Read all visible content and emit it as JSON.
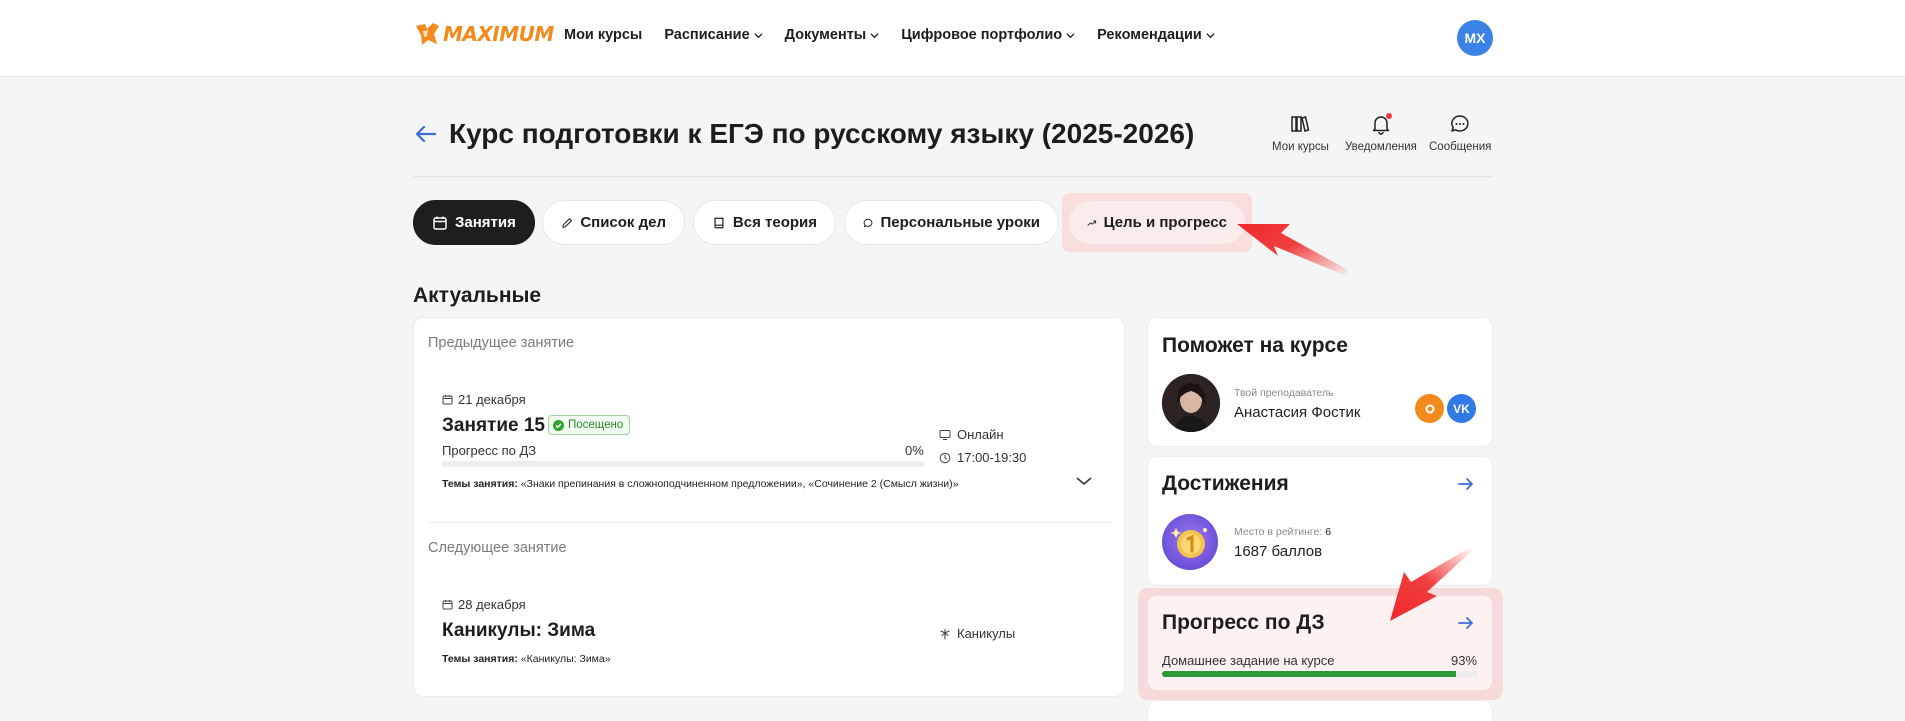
{
  "header": {
    "logo_text": "MAXIMUM",
    "nav": [
      {
        "label": "Мои курсы",
        "dropdown": false
      },
      {
        "label": "Расписание",
        "dropdown": true
      },
      {
        "label": "Документы",
        "dropdown": true
      },
      {
        "label": "Цифровое портфолио",
        "dropdown": true
      },
      {
        "label": "Рекомендации",
        "dropdown": true
      }
    ],
    "avatar_initials": "МХ"
  },
  "page": {
    "title": "Курс подготовки к ЕГЭ по русскому языку (2025-2026)",
    "quick_links": [
      {
        "label": "Мои курсы",
        "icon": "books-icon"
      },
      {
        "label": "Уведомления",
        "icon": "bell-icon",
        "has_dot": true
      },
      {
        "label": "Сообщения",
        "icon": "chat-icon"
      }
    ]
  },
  "tabs": [
    {
      "label": "Занятия",
      "icon": "calendar-icon",
      "active": true
    },
    {
      "label": "Список дел",
      "icon": "pencil-icon",
      "active": false
    },
    {
      "label": "Вся теория",
      "icon": "book-icon",
      "active": false
    },
    {
      "label": "Персональные уроки",
      "icon": "chat-bubble-icon",
      "active": false
    },
    {
      "label": "Цель и прогресс",
      "icon": "trend-icon",
      "active": false
    }
  ],
  "current": {
    "section_title": "Актуальные",
    "previous": {
      "heading": "Предыдущее занятие",
      "date": "21 декабря",
      "title": "Занятие 15",
      "badge": "Посещено",
      "progress_label": "Прогресс по ДЗ",
      "progress_text": "0%",
      "progress_value": 0,
      "format": "Онлайн",
      "time": "17:00-19:30",
      "topics_label": "Темы занятия:",
      "topics": "«Знаки препинания в сложноподчиненном предложении», «Сочинение 2 (Смысл жизни)»"
    },
    "next": {
      "heading": "Следующее занятие",
      "date": "28 декабря",
      "title": "Каникулы: Зима",
      "format": "Каникулы",
      "topics_label": "Темы занятия:",
      "topics": "«Каникулы: Зима»"
    }
  },
  "sidebar": {
    "helper": {
      "title": "Поможет на курсе",
      "role": "Твой преподаватель",
      "name": "Анастасия Фостик",
      "social": [
        "ok",
        "vk"
      ],
      "vk_label": "VK"
    },
    "achievements": {
      "title": "Достижения",
      "rank_label": "Место в рейтинге:",
      "rank_value": "6",
      "points": "1687 баллов"
    },
    "hw_progress": {
      "title": "Прогресс по ДЗ",
      "label": "Домашнее задание на курсе",
      "percent_text": "93%",
      "value": 93
    }
  },
  "colors": {
    "accent_orange": "#f28a1c",
    "avatar_blue": "#3b82e6",
    "progress_green": "#2a9a35",
    "annotation_red": "#ef2a2a"
  }
}
